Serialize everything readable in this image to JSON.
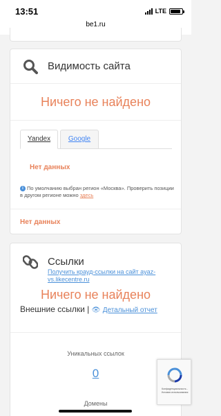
{
  "status_bar": {
    "time": "13:51",
    "network": "LTE"
  },
  "browser": {
    "url": "be1.ru"
  },
  "visibility": {
    "title": "Видимость сайта",
    "nothing_found": "Ничего не найдено",
    "tabs": [
      {
        "label": "Yandex"
      },
      {
        "label": "Google"
      }
    ],
    "no_data_1": "Нет данных",
    "info_text": "По умолчанию выбран регион «Москва». Проверить позиции в другом регионе можно ",
    "info_link": "здесь",
    "no_data_2": "Нет данных"
  },
  "links": {
    "title": "Ссылки",
    "crowd_link": "Получить крауд-ссылки на сайт ayaz-vs.likecentre.ru",
    "nothing_found": "Ничего не найдено",
    "external_label": "Внешние ссылки |",
    "detail_link": "Детальный отчет",
    "unique_label": "Уникальных ссылок",
    "unique_value": "0",
    "domains_label": "Домены"
  },
  "recaptcha": {
    "text": "Конфиденциальность - Условия использования"
  },
  "colors": {
    "accent_orange": "#e8825a",
    "link_blue": "#4a90d9"
  }
}
